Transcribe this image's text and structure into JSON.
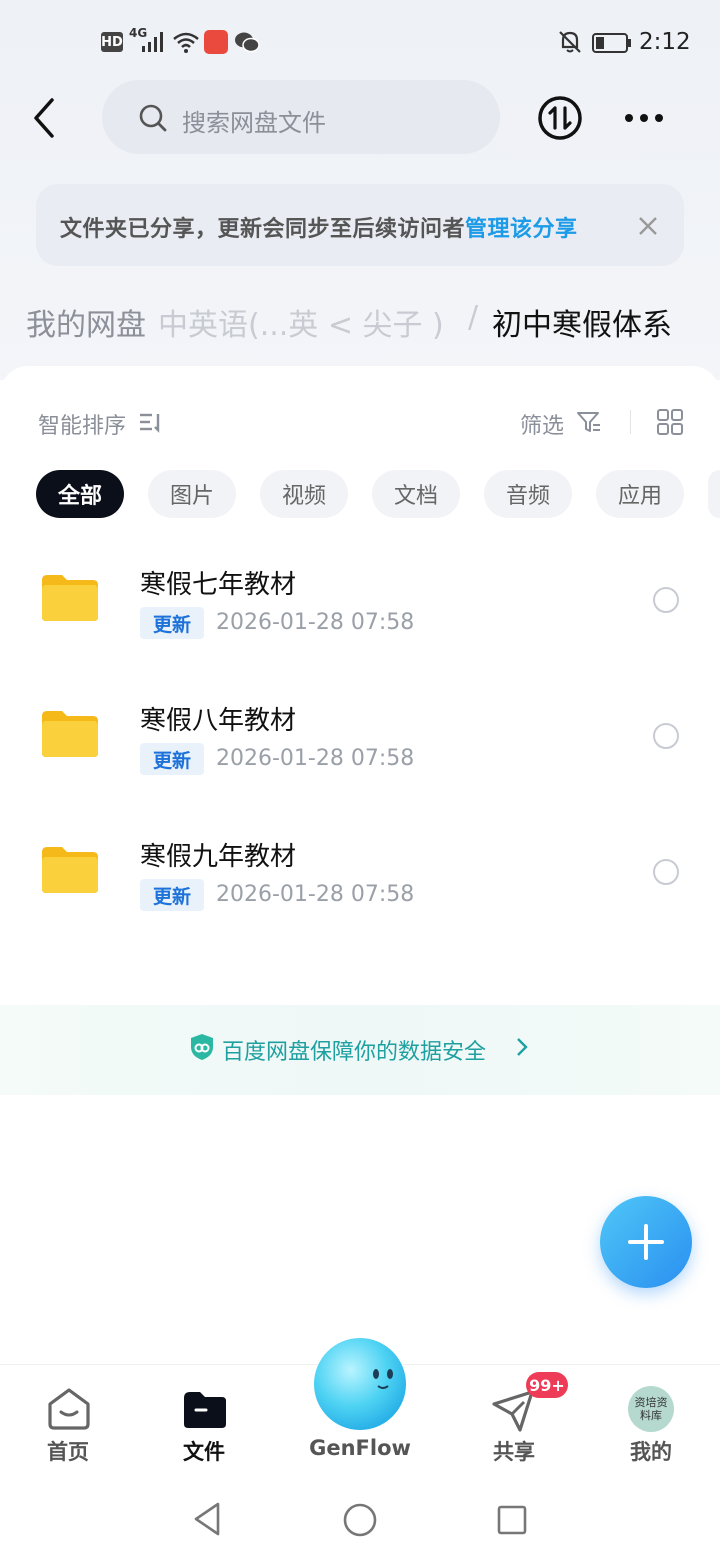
{
  "status_bar": {
    "hd": "HD",
    "network": "4G",
    "time": "2:12"
  },
  "header": {
    "search_placeholder": "搜索网盘文件",
    "transfer_icon": "transfer-icon",
    "more_icon": "more-icon"
  },
  "banner": {
    "text": "文件夹已分享，更新会同步至后续访问者",
    "link": "管理该分享"
  },
  "breadcrumb": {
    "items": [
      "我的网盘",
      "中英语(...英 < 尖子 )",
      "初中寒假体系"
    ],
    "separator": "/"
  },
  "toolbar": {
    "sort_label": "智能排序",
    "filter_label": "筛选"
  },
  "chips": [
    "全部",
    "图片",
    "视频",
    "文档",
    "音频",
    "应用"
  ],
  "files": [
    {
      "name": "寒假七年教材",
      "badge": "更新",
      "date": "2026-01-28  07:58"
    },
    {
      "name": "寒假八年教材",
      "badge": "更新",
      "date": "2026-01-28  07:58"
    },
    {
      "name": "寒假九年教材",
      "badge": "更新",
      "date": "2026-01-28  07:58"
    }
  ],
  "safety": {
    "text": "百度网盘保障你的数据安全"
  },
  "tabbar": {
    "items": [
      "首页",
      "文件",
      "GenFlow",
      "共享",
      "我的"
    ],
    "share_badge": "99+",
    "avatar_text": "资培资料库"
  },
  "colors": {
    "accent": "#1c9be8",
    "active_chip": "#0b0f1a",
    "folder": "#f9c62b",
    "badge_red": "#ee3b57"
  }
}
